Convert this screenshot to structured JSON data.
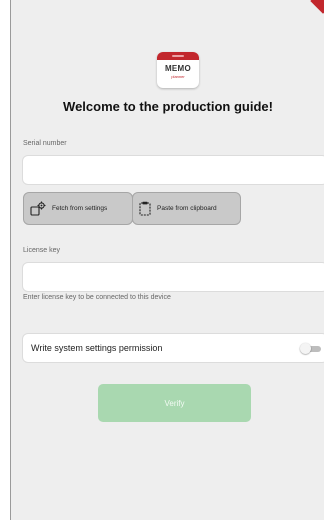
{
  "logo": {
    "title": "MEMO",
    "subtitle": "planner"
  },
  "page": {
    "title": "Welcome to the production guide!"
  },
  "serial": {
    "label": "Serial number",
    "value": "",
    "fetch_button": "Fetch from settings",
    "paste_button": "Paste from clipboard"
  },
  "license": {
    "label": "License key",
    "value": "",
    "helper": "Enter license key to be connected to this device"
  },
  "permission": {
    "label": "Write system settings permission",
    "enabled": false
  },
  "verify": {
    "label": "Verify",
    "enabled": false
  },
  "colors": {
    "brand": "#c2272d",
    "verify_disabled": "#a9d8b0",
    "background": "#eeeeee"
  },
  "icons": {
    "fetch": "settings-gear-icon",
    "paste": "clipboard-icon"
  }
}
